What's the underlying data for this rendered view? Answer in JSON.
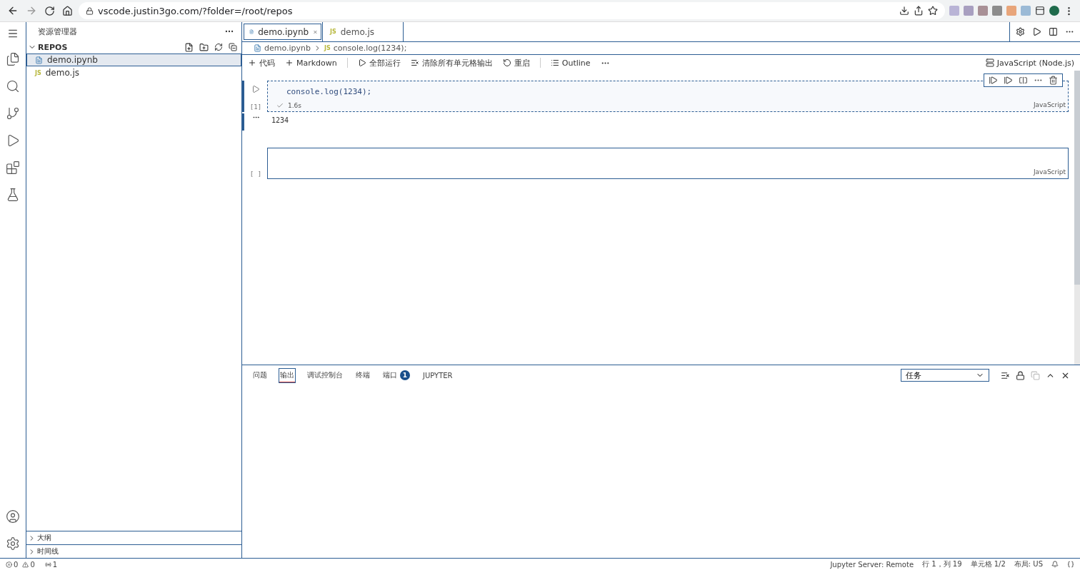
{
  "browser": {
    "url": "vscode.justin3go.com/?folder=/root/repos"
  },
  "sidebar": {
    "title": "资源管理器",
    "folder": "REPOS",
    "expanded": true,
    "files": [
      {
        "name": "demo.ipynb",
        "kind": "notebook",
        "selected": true
      },
      {
        "name": "demo.js",
        "kind": "js",
        "icon": "JS",
        "selected": false
      }
    ],
    "sections": [
      {
        "label": "大纲",
        "expanded": false
      },
      {
        "label": "时间线",
        "expanded": false
      }
    ]
  },
  "tabs": [
    {
      "label": "demo.ipynb",
      "kind": "notebook",
      "selected": true
    },
    {
      "label": "demo.js",
      "kind": "js",
      "icon": "JS",
      "selected": false
    }
  ],
  "breadcrumb": [
    {
      "label": "demo.ipynb",
      "kind": "notebook"
    },
    {
      "label": "console.log(1234);",
      "kind": "js",
      "icon": "JS"
    }
  ],
  "toolbar": {
    "items": [
      {
        "label": "代码",
        "kind": "plus"
      },
      {
        "label": "Markdown",
        "kind": "plus"
      },
      {
        "label": "全部运行",
        "kind": "run"
      },
      {
        "label": "清除所有单元格输出",
        "kind": "clear"
      },
      {
        "label": "重启",
        "kind": "restart"
      },
      {
        "label": "Outline",
        "kind": "outline"
      }
    ],
    "kernel": "JavaScript (Node.js)"
  },
  "cells": [
    {
      "code": "console.log(1234);",
      "count": "[1]",
      "status": "1.6s",
      "language": "JavaScript",
      "output": "1234",
      "selected": true
    },
    {
      "count": "[ ]",
      "language": "JavaScript",
      "selected": false
    }
  ],
  "panel": {
    "tabs": [
      {
        "label": "问题",
        "selected": false
      },
      {
        "label": "输出",
        "selected": true
      },
      {
        "label": "调试控制台",
        "selected": false
      },
      {
        "label": "终端",
        "selected": false
      },
      {
        "label": "端口",
        "selected": false,
        "badge": "1"
      },
      {
        "label": "JUPYTER",
        "selected": false
      }
    ],
    "channel": "任务"
  },
  "status_bar": {
    "errors": "0",
    "warnings": "0",
    "ports": "1",
    "right": [
      "Jupyter Server: Remote",
      "行 1，列 19",
      "单元格 1/2",
      "布局: US"
    ]
  }
}
